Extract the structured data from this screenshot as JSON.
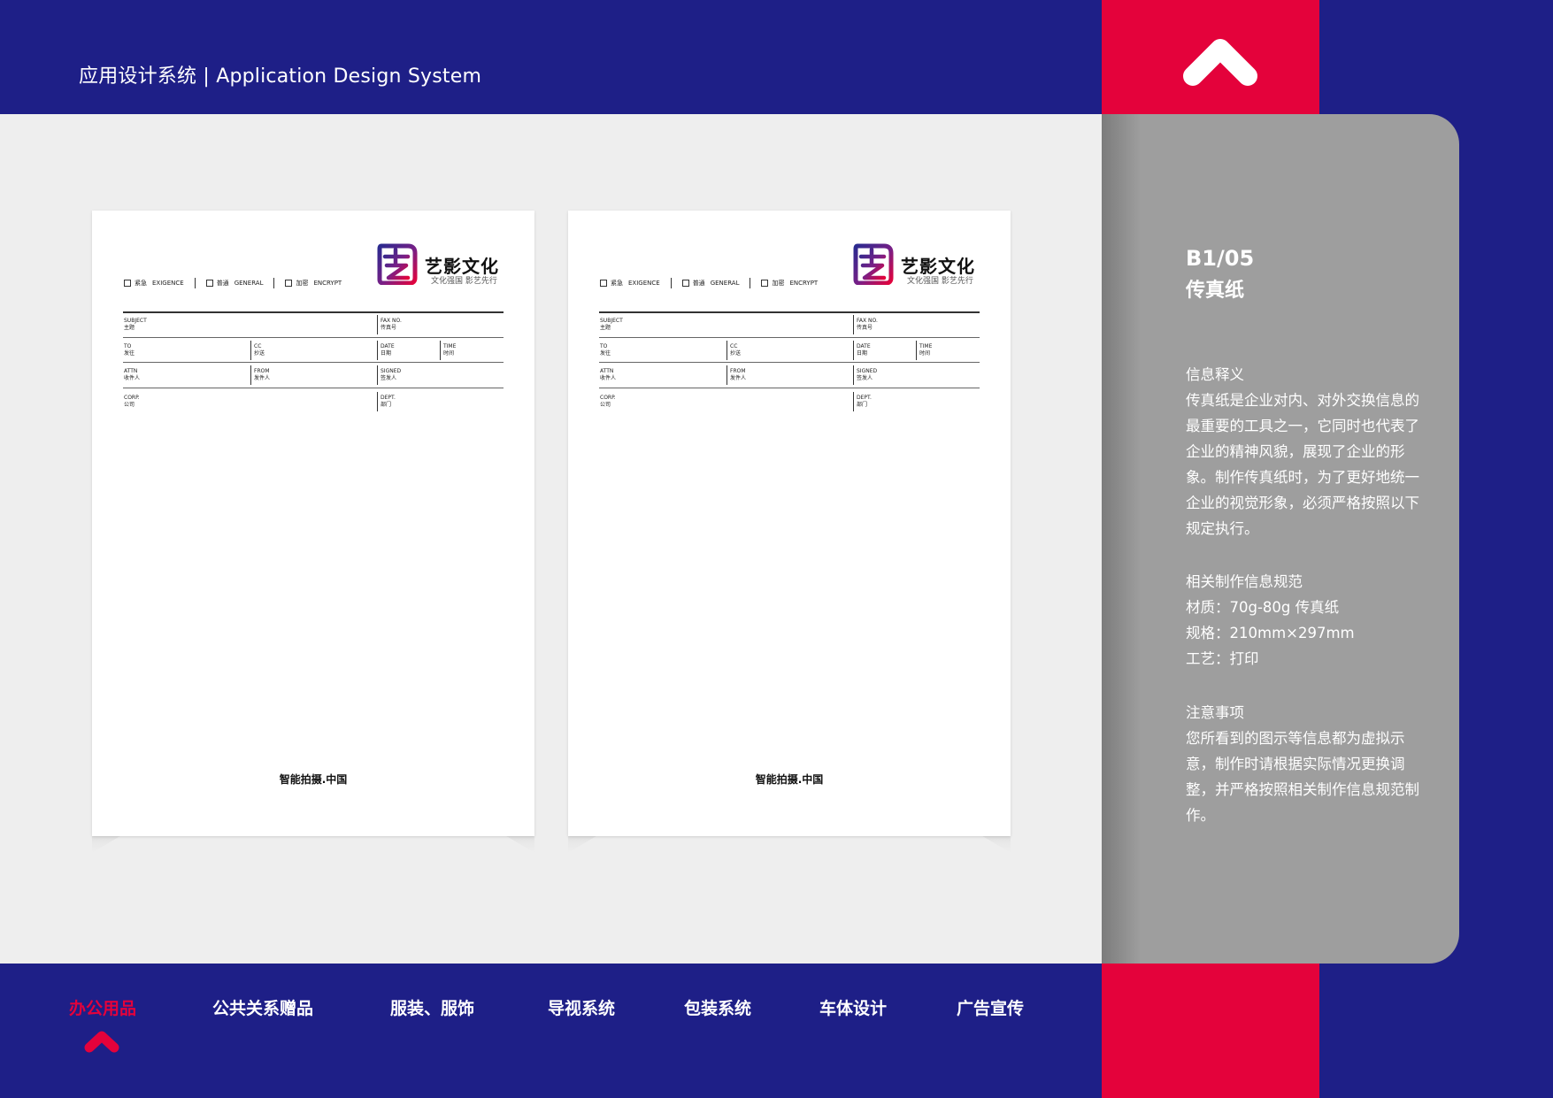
{
  "header": {
    "title": "应用设计系统 | Application Design System",
    "up_icon": "chevron-up-icon"
  },
  "colors": {
    "navy": "#1e1f87",
    "red": "#e4023b",
    "panel_gray": "#9e9e9e",
    "canvas_gray": "#eeeeee"
  },
  "fax_sheet": {
    "checkboxes": [
      {
        "cn": "紧急",
        "en": "EXIGENCE"
      },
      {
        "cn": "普通",
        "en": "GENERAL"
      },
      {
        "cn": "加密",
        "en": "ENCRYPT"
      }
    ],
    "logo": {
      "name": "艺影文化",
      "slogan": "文化强国  影艺先行",
      "icon": "yiying-logo-mark"
    },
    "fields": {
      "subject": {
        "en": "SUBJECT",
        "cn": "主题"
      },
      "fax_no": {
        "en": "FAX NO.",
        "cn": "传真号"
      },
      "to": {
        "en": "TO",
        "cn": "发往"
      },
      "cc": {
        "en": "CC",
        "cn": "抄送"
      },
      "date": {
        "en": "DATE",
        "cn": "日期"
      },
      "time": {
        "en": "TIME",
        "cn": "时间"
      },
      "attn": {
        "en": "ATTN",
        "cn": "收件人"
      },
      "from": {
        "en": "FROM",
        "cn": "发件人"
      },
      "signed": {
        "en": "SIGNED",
        "cn": "签发人"
      },
      "corp": {
        "en": "CORP.",
        "cn": "公司"
      },
      "dept": {
        "en": "DEPT.",
        "cn": "部门"
      }
    },
    "footer": "智能拍摄.中国"
  },
  "info": {
    "code": "B1/05",
    "name": "传真纸",
    "sections": [
      {
        "title": "信息释义",
        "lines": [
          "传真纸是企业对内、对外交换信息的最重要的工具之一，它同时也代表了企业的精神风貌，展现了企业的形象。制作传真纸时，为了更好地统一企业的视觉形象，必须严格按照以下规定执行。"
        ]
      },
      {
        "title": "相关制作信息规范",
        "lines": [
          "材质：70g-80g 传真纸",
          "规格：210mm×297mm",
          "工艺：打印"
        ]
      },
      {
        "title": "注意事项",
        "lines": [
          "您所看到的图示等信息都为虚拟示意，制作时请根据实际情况更换调整，并严格按照相关制作信息规范制作。"
        ]
      }
    ]
  },
  "nav": {
    "items": [
      {
        "label": "办公用品",
        "active": true
      },
      {
        "label": "公共关系赠品",
        "active": false
      },
      {
        "label": "服装、服饰",
        "active": false
      },
      {
        "label": "导视系统",
        "active": false
      },
      {
        "label": "包装系统",
        "active": false
      },
      {
        "label": "车体设计",
        "active": false
      },
      {
        "label": "广告宣传",
        "active": false
      }
    ],
    "indicator_icon": "chevron-up-icon"
  }
}
